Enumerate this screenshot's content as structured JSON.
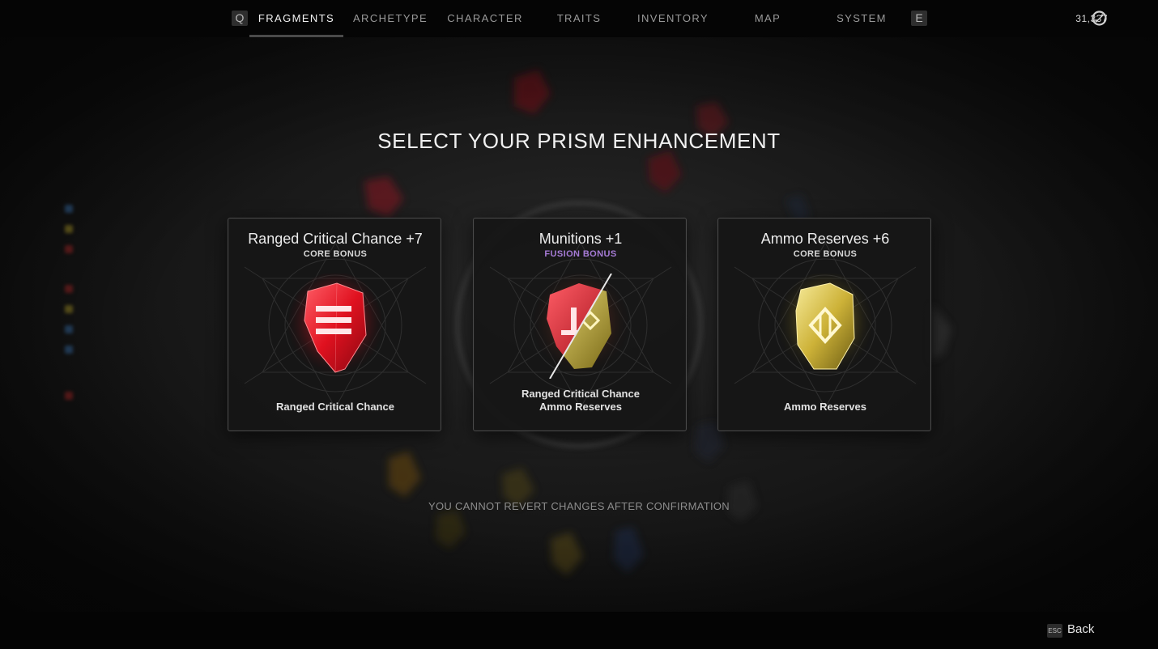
{
  "nav": {
    "left_key": "Q",
    "right_key": "E",
    "tabs": [
      {
        "label": "FRAGMENTS",
        "active": true
      },
      {
        "label": "ARCHETYPE",
        "active": false
      },
      {
        "label": "CHARACTER",
        "active": false
      },
      {
        "label": "TRAITS",
        "active": false
      },
      {
        "label": "INVENTORY",
        "active": false
      },
      {
        "label": "MAP",
        "active": false
      },
      {
        "label": "SYSTEM",
        "active": false
      }
    ],
    "currency": "31,337",
    "currency_icon": "scrap-currency-icon"
  },
  "heading": "SELECT YOUR PRISM ENHANCEMENT",
  "cards": [
    {
      "title": "Ranged Critical Chance +7",
      "kind": "CORE BONUS",
      "gem_icon": "red-fragment-gem-icon",
      "stats": [
        "Ranged Critical Chance"
      ]
    },
    {
      "title": "Munitions +1",
      "kind": "FUSION BONUS",
      "gem_icon": "red-yellow-fusion-gem-icon",
      "stats": [
        "Ranged Critical Chance",
        "Ammo Reserves"
      ]
    },
    {
      "title": "Ammo Reserves +6",
      "kind": "CORE BONUS",
      "gem_icon": "yellow-fragment-gem-icon",
      "stats": [
        "Ammo Reserves"
      ]
    }
  ],
  "warning": "YOU CANNOT REVERT CHANGES AFTER CONFIRMATION",
  "footer": {
    "esc_key": "ESC",
    "back_label": "Back"
  },
  "colors": {
    "fusion": "#a67bd6",
    "red_fragment": "#ff2a3a",
    "yellow_fragment": "#e8d25a"
  }
}
